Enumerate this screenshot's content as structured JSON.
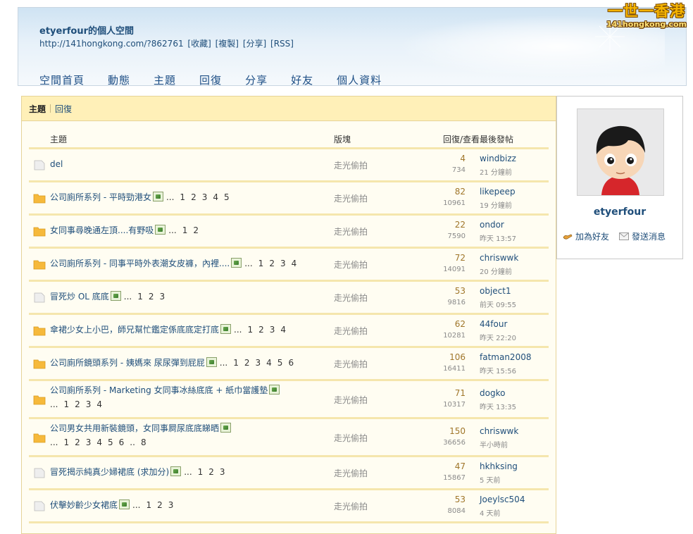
{
  "header": {
    "title": "etyerfour的個人空間",
    "url": "http://141hongkong.com/?862761",
    "links": [
      "[收藏]",
      "[複製]",
      "[分享]",
      "[RSS]"
    ],
    "logo_main": "一世一香港",
    "logo_sub": "141hongkong.com"
  },
  "nav": [
    "空間首頁",
    "動態",
    "主題",
    "回復",
    "分享",
    "好友",
    "個人資料"
  ],
  "tabs": {
    "active": "主題",
    "other": "回復"
  },
  "table": {
    "headers": {
      "subject": "主題",
      "board": "版塊",
      "stats": "回復/查看最後發帖"
    },
    "rows": [
      {
        "icon": "file",
        "title": "del",
        "line2": "",
        "pages": [],
        "board": "走光偷拍",
        "replies": "4",
        "views": "734",
        "author": "windbizz",
        "time": "21 分鐘前"
      },
      {
        "icon": "folder",
        "title": "公司廁所系列 - 平時勁港女",
        "pages": [
          "...",
          "1",
          "2",
          "3",
          "4",
          "5"
        ],
        "board": "走光偷拍",
        "replies": "82",
        "views": "10961",
        "author": "likepeep",
        "time": "19 分鐘前"
      },
      {
        "icon": "folder",
        "title": "女同事尋晚通左頂....有野吸",
        "pages": [
          "...",
          "1",
          "2"
        ],
        "board": "走光偷拍",
        "replies": "22",
        "views": "7590",
        "author": "ondor",
        "time": "昨天 13:57"
      },
      {
        "icon": "folder",
        "title": "公司廁所系列 - 同事平時外表潮女皮褲，內裡....",
        "pages": [
          "...",
          "1",
          "2",
          "3",
          "4"
        ],
        "board": "走光偷拍",
        "replies": "72",
        "views": "14091",
        "author": "chriswwk",
        "time": "20 分鐘前"
      },
      {
        "icon": "file",
        "title": "冒死炒 OL 底底",
        "pages": [
          "...",
          "1",
          "2",
          "3"
        ],
        "board": "走光偷拍",
        "replies": "53",
        "views": "9816",
        "author": "object1",
        "time": "前天 09:55"
      },
      {
        "icon": "folder",
        "title": "傘裙少女上小巴，師兄幫忙鑑定係底底定打底",
        "pages": [
          "...",
          "1",
          "2",
          "3",
          "4"
        ],
        "board": "走光偷拍",
        "replies": "62",
        "views": "10281",
        "author": "44four",
        "time": "昨天 22:20"
      },
      {
        "icon": "folder",
        "title": "公司廁所鏡頭系列 - 姨媽來 尿尿彈到屁屁",
        "pages": [
          "...",
          "1",
          "2",
          "3",
          "4",
          "5",
          "6"
        ],
        "board": "走光偷拍",
        "replies": "106",
        "views": "16411",
        "author": "fatman2008",
        "time": "昨天 15:56"
      },
      {
        "icon": "folder",
        "title": "公司廁所系列 - Marketing 女同事冰絲底底 + 紙巾當護墊",
        "pages2": [
          "...",
          "1",
          "2",
          "3",
          "4"
        ],
        "board": "走光偷拍",
        "replies": "71",
        "views": "10317",
        "author": "dogko",
        "time": "昨天 13:35"
      },
      {
        "icon": "folder",
        "title": "公司男女共用新裝鏡頭，女同事屙尿底底睇晒",
        "pages2": [
          "...",
          "1",
          "2",
          "3",
          "4",
          "5",
          "6",
          "..",
          "8"
        ],
        "board": "走光偷拍",
        "replies": "150",
        "views": "36656",
        "author": "chriswwk",
        "time": "半小時前"
      },
      {
        "icon": "file",
        "title": "冒死揭示純真少婦裙底 (求加分)",
        "pages": [
          "...",
          "1",
          "2",
          "3"
        ],
        "board": "走光偷拍",
        "replies": "47",
        "views": "15867",
        "author": "hkhksing",
        "time": "5 天前"
      },
      {
        "icon": "file",
        "title": "伏擊妙齡少女裙底",
        "pages": [
          "...",
          "1",
          "2",
          "3"
        ],
        "board": "走光偷拍",
        "replies": "53",
        "views": "8084",
        "author": "Joeylsc504",
        "time": "4 天前"
      }
    ]
  },
  "profile": {
    "name": "etyerfour",
    "add_friend": "加為好友",
    "send_message": "發送消息"
  },
  "colors": {
    "link": "#1f4e7a",
    "tabbar": "#fff0b8",
    "row_border": "#f5e6ad",
    "replies": "#a0762a"
  }
}
